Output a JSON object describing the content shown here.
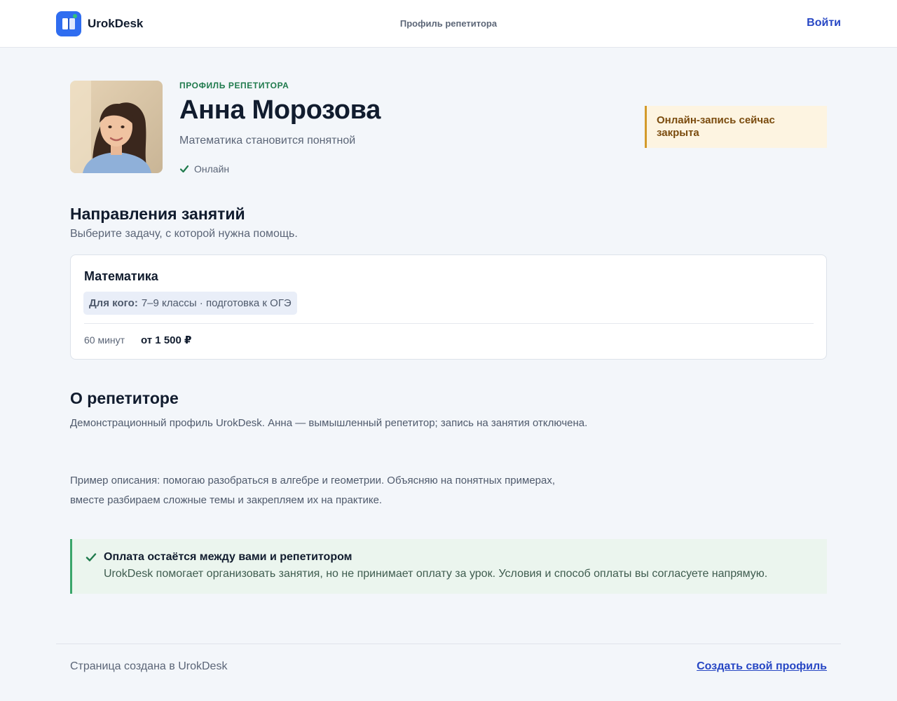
{
  "header": {
    "brand": "UrokDesk",
    "nav_title": "Профиль репетитора",
    "login_label": "Войти",
    "brand_color": "#2f6df0"
  },
  "profile": {
    "eyebrow": "ПРОФИЛЬ РЕПЕТИТОРА",
    "name": "Анна Морозова",
    "tagline": "Математика становится понятной",
    "status": "Онлайн",
    "status_icon": "check-icon",
    "booking_notice": "Онлайн-запись сейчас закрыта"
  },
  "directions": {
    "title": "Направления занятий",
    "subtitle": "Выберите задачу, с которой нужна помощь.",
    "cards": [
      {
        "title": "Математика",
        "audience_label": "Для кого:",
        "audience_value": "7–9 классы · подготовка к ОГЭ",
        "duration": "60 минут",
        "price": "от 1 500 ₽"
      }
    ]
  },
  "about": {
    "title": "О репетиторе",
    "paragraphs": [
      "Демонстрационный профиль UrokDesk. Анна — вымышленный репетитор; запись на занятия отключена.",
      "Пример описания: помогаю разобраться в алгебре и геометрии. Объясняю на понятных примерах, вместе разбираем сложные темы и закрепляем их на практике."
    ]
  },
  "payment_notice": {
    "title": "Оплата остаётся между вами и репетитором",
    "text": "UrokDesk помогает организовать занятия, но не принимает оплату за урок. Условия и способ оплаты вы согласуете напрямую."
  },
  "footer": {
    "text": "Страница создана в UrokDesk",
    "link": "Создать свой профиль"
  }
}
